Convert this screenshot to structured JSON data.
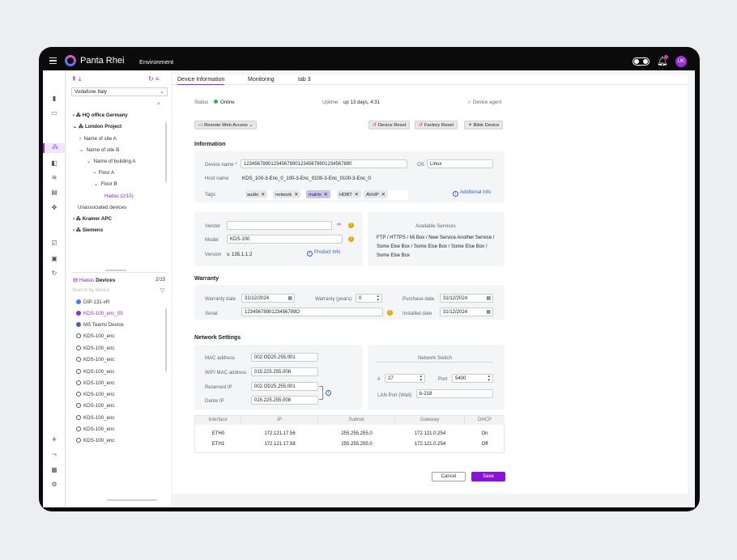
{
  "app": {
    "brand": "Panta Rhei",
    "environment": "Environment",
    "user_initials": "UK"
  },
  "sidebar": {
    "org_select": "Vodafone Italy",
    "tree": [
      {
        "label": "HQ office Germany",
        "bold": true
      },
      {
        "label": "London Project",
        "bold": true
      },
      {
        "label": "Name of site  A"
      },
      {
        "label": "Name of site  B"
      },
      {
        "label": "Name of building A"
      },
      {
        "label": "Floor A"
      },
      {
        "label": "Floor B"
      },
      {
        "label": "Hadas (2/15)"
      },
      {
        "label": "Unassociated devices"
      },
      {
        "label": "Kramer APC",
        "bold": true
      },
      {
        "label": "Siemens",
        "bold": true
      }
    ],
    "devices_header": {
      "name": "Hadas",
      "suffix": "Devices",
      "count": "2/15"
    },
    "device_search_placeholder": "Search by device",
    "devices": [
      "DIP-131-xR",
      "KDS-100_enc_05",
      "MS Teams Device",
      "KDS-100_enc",
      "KDS-100_enc",
      "KDS-100_enc",
      "KDS-100_enc",
      "KDS-100_enc",
      "KDS-100_enc",
      "KDS-100_enc",
      "KDS-100_enc",
      "KDS-100_enc",
      "KDS-100_enc"
    ]
  },
  "tabs": [
    "Device Information",
    "Monitoring",
    "tab 3"
  ],
  "status": {
    "label": "Status",
    "value": "Online",
    "uptime_label": "Uptime",
    "uptime": "up 13 days, 4:31",
    "agent": "Device agent"
  },
  "actions": {
    "remote": "Remote Web Access",
    "reset": "Device Reset",
    "factory": "Factory Reset",
    "blink": "Blink Device"
  },
  "information": {
    "title": "Information",
    "device_name_label": "Device name *",
    "device_name": "1234567890123456789012345678901234567890",
    "os_label": "OS",
    "os": "Linux",
    "host_label": "Host name",
    "host": "KDS_100-3-Enc_0_100-3-Enc_0100-3-Enc_0100-3-Enc_0",
    "tags_label": "Tags",
    "tags": [
      "audio",
      "network",
      "matrix",
      "HDBT",
      "AVoIP"
    ],
    "additional": "Additional Info",
    "vendor_label": "Vendor",
    "vendor": "",
    "model_label": "Model",
    "model": "KDS-100",
    "version_label": "Version",
    "version": "v. 135.1.1.2",
    "product_info": "Product Info",
    "services_title": "Available Services",
    "services": "FTP / HTTPS / Mi Box / New Service Another Service / Some Else Box / Some Else Box / Some Else Box / Some Else Box"
  },
  "warranty": {
    "title": "Warranty",
    "date_label": "Warranty date",
    "date": "31/12/2024",
    "years_label": "Warranty (years)",
    "years": "0",
    "purchase_label": "Purchase date",
    "purchase": "31/12/2024",
    "serial_label": "Serial",
    "serial": "1234567890123456789O",
    "installed_label": "Installed date",
    "installed": "31/12/2024"
  },
  "network": {
    "title": "Network Settings",
    "mac_label": "MAC address",
    "mac": "002:OD25.255.001",
    "wifi_label": "WIFI MAC address",
    "wifi": "015.225.255.008",
    "reserved_label": "Reserved IP",
    "reserved": "002.OD25.255.001",
    "dante_label": "Dante IP",
    "dante": "015.225.255.008",
    "switch_title": "Network Switch",
    "num_label": "#",
    "num": "27",
    "port_label": "Port",
    "port": "5400",
    "lan_label": "LAN Port (Wall)",
    "lan": "b-218",
    "table": {
      "headers": [
        "Interface",
        "IP",
        "Subnet",
        "Gateway",
        "DHCP"
      ],
      "rows": [
        [
          "ETH0",
          "172.121.17.56",
          "255.255.255.0",
          "172.121.0.254",
          "On"
        ],
        [
          "ETH1",
          "172.121.17.58",
          "255.255.255.0",
          "172.121.0.254",
          "Off"
        ]
      ]
    }
  },
  "footer": {
    "cancel": "Cancel",
    "save": "Save"
  }
}
